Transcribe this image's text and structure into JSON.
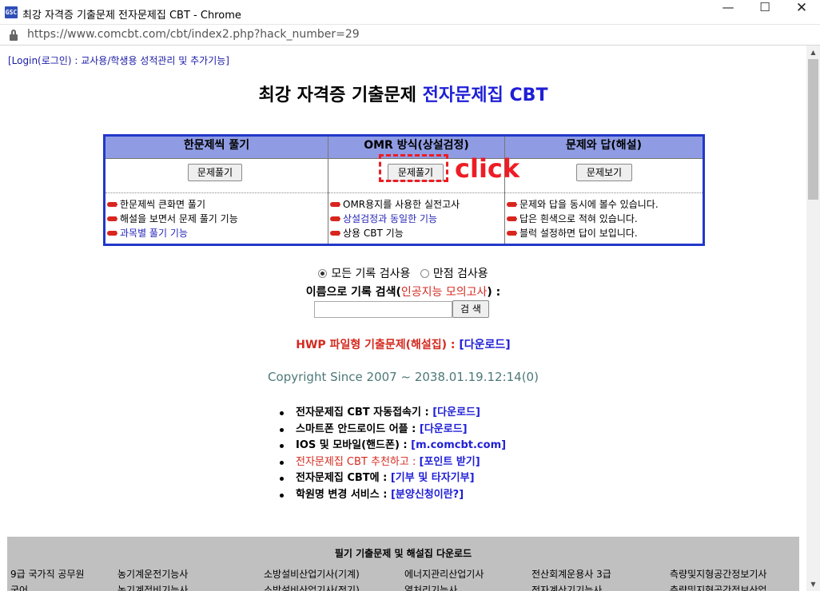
{
  "window": {
    "app_icon_text": "GSC",
    "title": "최강 자격증 기출문제 전자문제집 CBT - Chrome",
    "minimize": "—",
    "maximize": "☐",
    "close": "✕"
  },
  "address_bar": {
    "url": "https://www.comcbt.com/cbt/index2.php?hack_number=29"
  },
  "page": {
    "login_link": "[Login(로그인) : 교사용/학생용 성적관리 및 추가기능]",
    "title_black": "최강 자격증 기출문제 ",
    "title_blue": "전자문제집 CBT",
    "modes": [
      {
        "header": "한문제씩 풀기",
        "button": "문제풀기",
        "features": [
          "한문제씩 큰화면 풀기",
          "해설을 보면서 문제 풀기 기능",
          "과목별 풀기 기능"
        ]
      },
      {
        "header": "OMR 방식(상설검정)",
        "button": "문제풀기",
        "features": [
          "OMR용지를 사용한 실전고사",
          "상설검정과 동일한 기능",
          "상용 CBT 기능"
        ]
      },
      {
        "header": "문제와 답(해설)",
        "button": "문제보기",
        "features": [
          "문제와 답을 동시에 볼수 있습니다.",
          "답은 흰색으로 적혀 있습니다.",
          "블럭 설정하면 답이 보입니다."
        ]
      }
    ],
    "annotation": {
      "label": "click",
      "color": "#ee1c24"
    },
    "search": {
      "radio_all": "모든 기록 검사용",
      "radio_perfect": "만점 검사용",
      "selected": "모든 기록 검사용",
      "label_prefix": "이름으로 기록 검색(",
      "label_ai": "인공지능 모의고사",
      "label_suffix": ") :",
      "input_value": "",
      "button": "검 색"
    },
    "hwp": {
      "text": "HWP 파일형 기출문제(해설집) : ",
      "link": "[다운로드]"
    },
    "copyright": "Copyright Since 2007 ~ 2038.01.19.12:14(0)",
    "bullets": [
      {
        "text": "전자문제집 CBT 자동접속기 : ",
        "link": "[다운로드]"
      },
      {
        "text": "스마트폰 안드로이드 어플 : ",
        "link": "[다운로드]"
      },
      {
        "text": "IOS 및 모바일(핸드폰) : ",
        "link": "[m.comcbt.com]"
      },
      {
        "text": "전자문제집 CBT 추천하고 : ",
        "link": "[포인트 받기]"
      },
      {
        "text": "전자문제집 CBT에 : ",
        "link": "[기부 및 타자기부]"
      },
      {
        "text": "학원명 변경 서비스 : ",
        "link": "[분양신청이란?]"
      }
    ],
    "downloads": {
      "title": "필기 기출문제 및 해설집 다운로드",
      "row1": [
        "9급 국가직 공무원",
        "농기계운전기능사",
        "소방설비산업기사(기계)",
        "에너지관리산업기사",
        "전산회계운용사 3급",
        "측량및지형공간정보기사"
      ],
      "row2": [
        "국어",
        "농기계정비기능사",
        "소방설비산업기사(전기)",
        "열처리기능사",
        "전자계산기기능사",
        "측량및지형공간정보산업"
      ]
    }
  },
  "colors": {
    "accent_blue": "#1f1fd6",
    "table_border": "#2238c8",
    "table_header": "#8f9ce3",
    "alert_red": "#d42a1f"
  }
}
